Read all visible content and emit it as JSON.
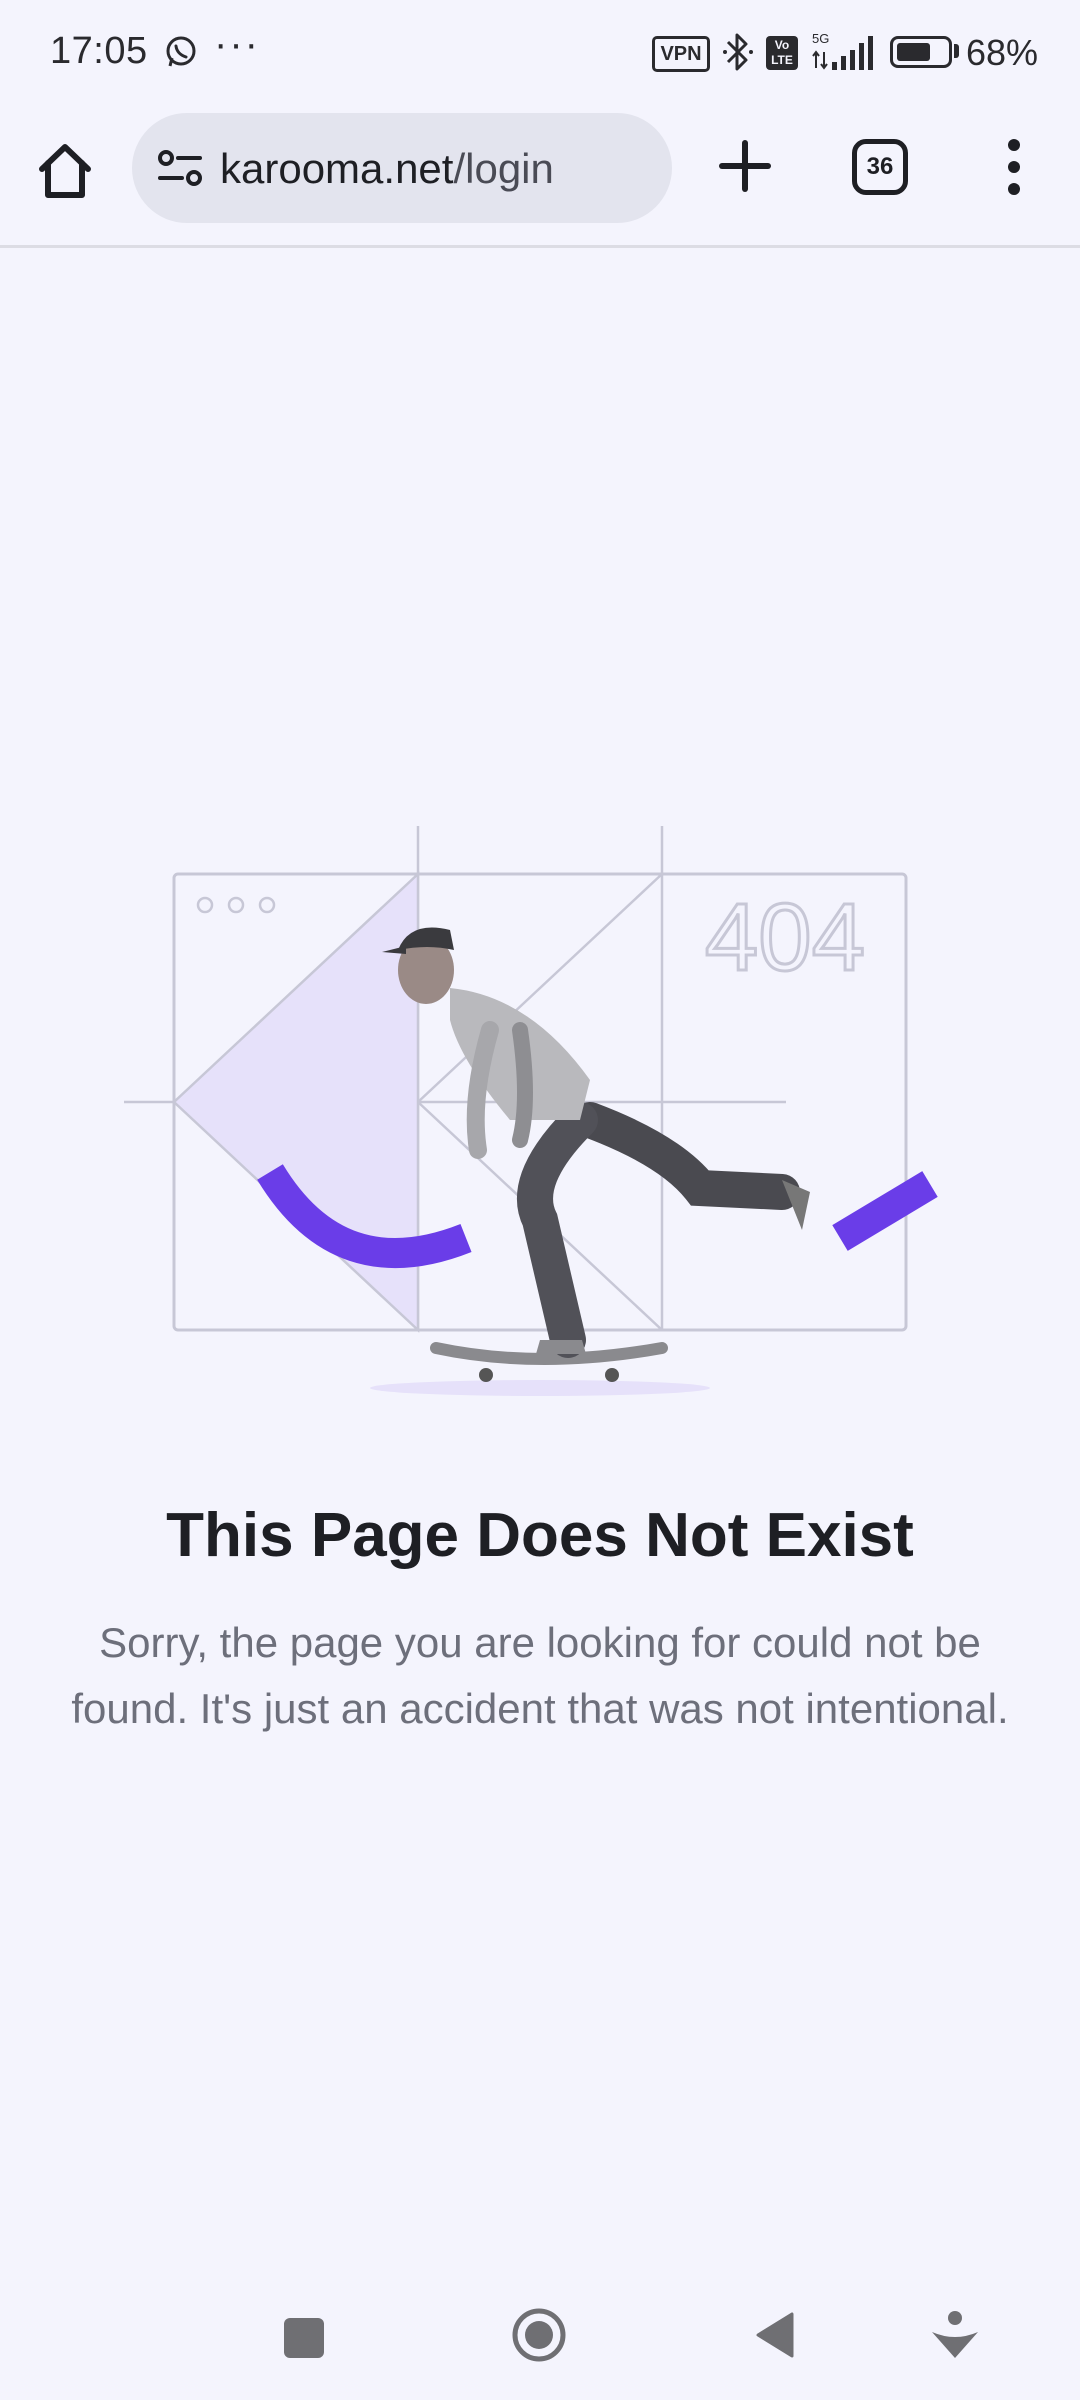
{
  "status_bar": {
    "time": "17:05",
    "notification_icons": [
      "whatsapp-icon",
      "more-dots-icon"
    ],
    "vpn_label": "VPN",
    "volte_label": "Vo LTE",
    "network_label": "5G",
    "battery_percent": "68%",
    "battery_level": 0.68
  },
  "browser": {
    "url_host": "karooma.net",
    "url_path": "/login",
    "tab_count": "36",
    "icons": [
      "home-icon",
      "site-settings-icon",
      "plus-icon",
      "tabs-icon",
      "more-vert-icon"
    ]
  },
  "page": {
    "illustration_label": "404",
    "title": "This Page Does Not Exist",
    "subtitle": "Sorry, the page you are looking for could not be found. It's just an accident that was not intentional.",
    "accent_color": "#6a3de8"
  },
  "nav_bar": {
    "icons": [
      "recents-icon",
      "home-circle-icon",
      "back-icon",
      "assistant-icon"
    ]
  }
}
